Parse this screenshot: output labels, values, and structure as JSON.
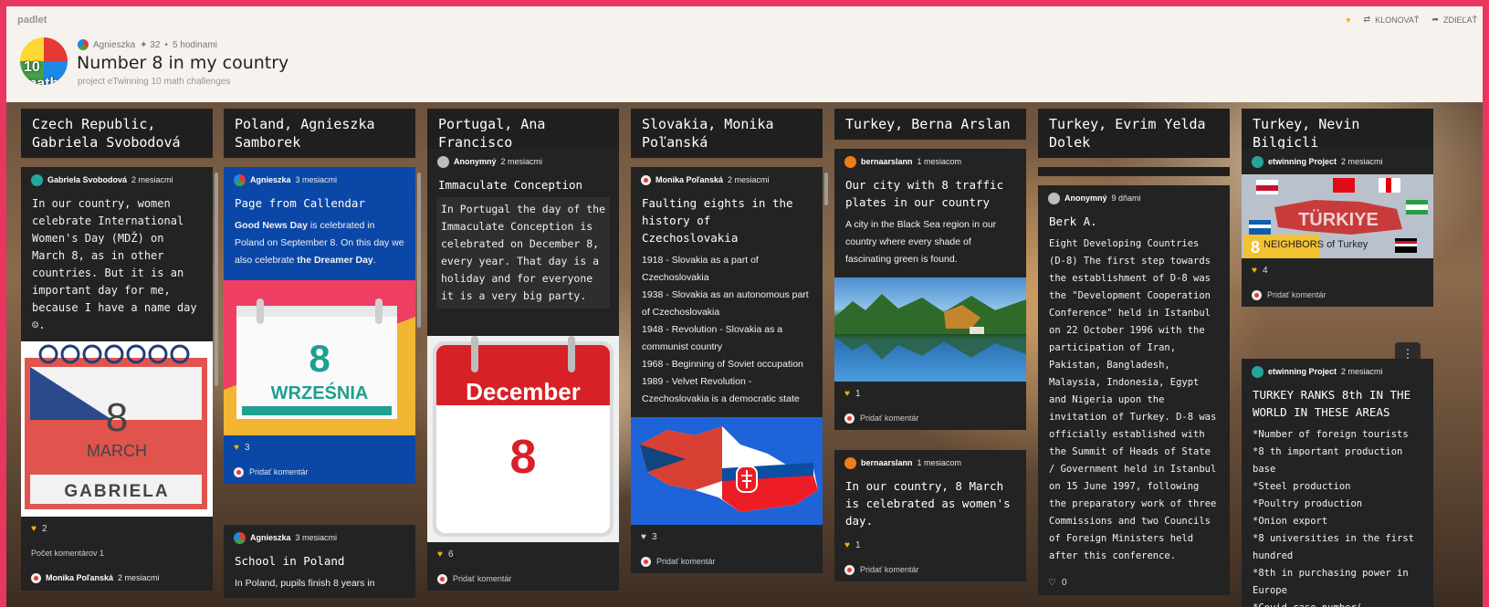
{
  "header": {
    "brand": "padlet",
    "clone_label": "KLONOVAŤ",
    "share_label": "ZDIEĽAŤ",
    "author": "Agnieszka",
    "likes": "✦ 32",
    "separator": "•",
    "time": "5 hodinami",
    "title": "Number 8 in my country",
    "subtitle": "project eTwinning 10 math challenges",
    "avatar_text": "10 math"
  },
  "colors": {
    "accent": "#e8365f",
    "like": "#f4b400",
    "post_bg": "#232323",
    "header_bg": "#f6f3ee"
  },
  "columns": [
    {
      "title": "Czech Republic, Gabriela Svobodová"
    },
    {
      "title": "Poland, Agnieszka Samborek"
    },
    {
      "title": "Portugal, Ana Francisco"
    },
    {
      "title": "Slovakia, Monika Poľanská"
    },
    {
      "title": "Turkey, Berna Arslan"
    },
    {
      "title": "Turkey, Evrim Yelda Dolek"
    },
    {
      "title": "Turkey, Nevin Bilgicli"
    }
  ],
  "posts": {
    "cz1": {
      "author": "Gabriela Svobodová",
      "time": "2 mesiacmi",
      "body": "In our country, women celebrate International Women's Day (MDŽ) on March 8, as in other countries. But it is an important day for me, because I have a name day ☺.",
      "img_8": "8",
      "img_march": "MARCH",
      "img_name": "GABRIELA",
      "likes": "2",
      "comments_count": "Počet komentárov 1"
    },
    "cz_c1": {
      "author": "Monika Poľanská",
      "time": "2 mesiacmi"
    },
    "pl1": {
      "author": "Agnieszka",
      "time": "3 mesiacmi",
      "subject": "Page from Callendar",
      "body_bold1": "Good News Day",
      "body_1": " is celebrated in Poland on September 8. On this day we also celebrate ",
      "body_bold2": "the Dreamer Day",
      "body_2": ".",
      "img_8": "8",
      "img_month": "WRZEŚNIA",
      "likes": "3",
      "comment_label": "Pridať komentár"
    },
    "pl2": {
      "author": "Agnieszka",
      "time": "3 mesiacmi",
      "subject": "School in Poland",
      "body": "In Poland, pupils finish 8 years in"
    },
    "pt1": {
      "author": "Anonymný",
      "time": "2 mesiacmi",
      "subject": "Immaculate Conception",
      "body": "In Portugal the day of the Immaculate Conception is celebrated on December 8, every year. That day is a holiday and for everyone it is a very big party.",
      "img_month": "December",
      "img_8": "8",
      "likes": "6",
      "comment_label": "Pridať komentár"
    },
    "sk1": {
      "author": "Monika Poľanská",
      "time": "2 mesiacmi",
      "subject": "Faulting eights in the history of Czechoslovakia",
      "lines": [
        "1918 - Slovakia as a part of Czechoslovakia",
        "1938 - Slovakia as an autonomous part of Czechoslovakia",
        "1948 - Revolution - Slovakia as a communist country",
        "1968 - Beginning of Soviet occupation",
        "1989 - Velvet Revolution - Czechoslovakia is a democratic state"
      ],
      "likes": "3",
      "comment_label": "Pridať komentár"
    },
    "tr1": {
      "author": "bernaarslann",
      "time": "1 mesiacom",
      "subject": "Our city with 8 traffic plates in our country",
      "body": "A city in the Black Sea region in our country where every shade of fascinating green is found.",
      "likes": "1",
      "comment_label": "Pridať komentár"
    },
    "tr2": {
      "author": "bernaarslann",
      "time": "1 mesiacom",
      "subject": "In our country, 8 March is celebrated as women's day.",
      "likes": "1",
      "comment_label": "Pridať komentár"
    },
    "ey1": {
      "author": "Anonymný",
      "time": "9 dňami",
      "subject": "Berk A.",
      "body": "Eight Developing Countries (D-8) The first step towards the establishment of D-8 was the \"Development Cooperation Conference\" held in Istanbul on 22 October 1996 with the participation of Iran, Pakistan, Bangladesh, Malaysia, Indonesia, Egypt and Nigeria upon the invitation of Turkey. D-8 was officially established with the Summit of Heads of State / Government held in Istanbul on 15 June 1997, following the preparatory work of three Commissions and two Councils of Foreign Ministers held after this conference.",
      "likes": "0"
    },
    "nb1": {
      "author": "etwinning Project",
      "time": "2 mesiacmi",
      "img_country": "TÜRKIYE",
      "img_8": "8",
      "img_label": "NEIGHBORS of Turkey",
      "likes": "4",
      "comment_label": "Pridať komentár"
    },
    "nb2": {
      "author": "etwinning Project",
      "time": "2 mesiacmi",
      "subject": "TURKEY RANKS 8th IN THE WORLD IN THESE AREAS",
      "lines": [
        "*Number of foreign tourists",
        "*8 th important production base",
        "*Steel production",
        "*Poultry production",
        "*Onion export",
        "*8 universities in the first hundred",
        "*8th in purchasing power in Europe",
        "*Covid case number("
      ]
    }
  }
}
